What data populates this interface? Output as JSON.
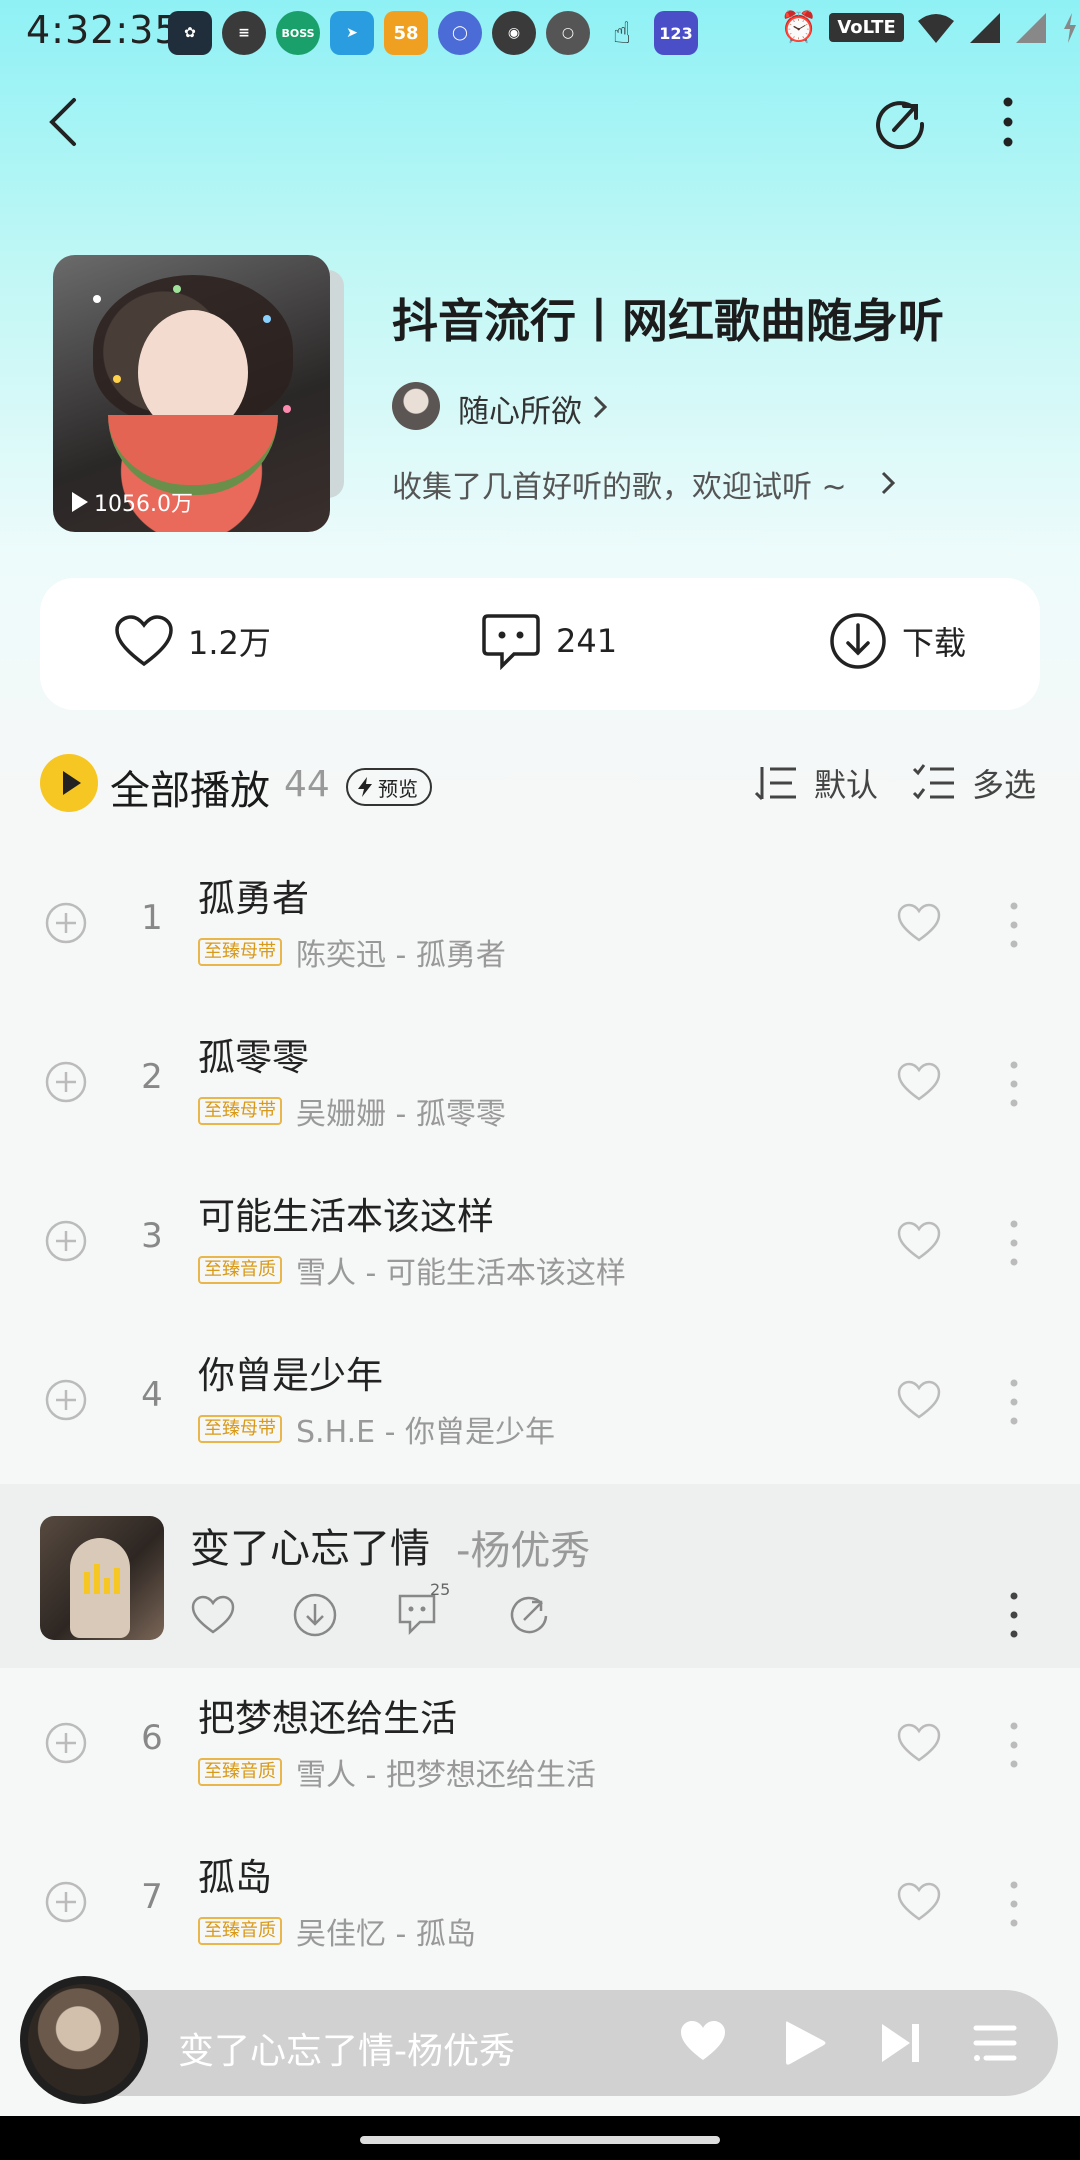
{
  "status_bar": {
    "time": "4:32:35",
    "badges": {
      "boss": "BOSS",
      "fifty_eight": "58",
      "num": "123",
      "volte": "VoLTE"
    }
  },
  "header": {
    "back_icon": "chevron-left-icon",
    "share_icon": "share-icon",
    "more_icon": "more-vertical-icon"
  },
  "playlist": {
    "title": "抖音流行丨网红歌曲随身听",
    "play_count": "1056.0万",
    "creator": "随心所欲",
    "description": "收集了几首好听的歌，欢迎试听 ~"
  },
  "actions": {
    "like_count": "1.2万",
    "comment_count": "241",
    "download_label": "下载"
  },
  "play_all": {
    "label": "全部播放",
    "count": "44",
    "preview_label": "预览",
    "sort_label": "默认",
    "multi_select_label": "多选"
  },
  "songs": [
    {
      "num": "1",
      "title": "孤勇者",
      "badge": "至臻母带",
      "artist": "陈奕迅 - 孤勇者"
    },
    {
      "num": "2",
      "title": "孤零零",
      "badge": "至臻母带",
      "artist": "吴姗姗 - 孤零零"
    },
    {
      "num": "3",
      "title": "可能生活本该这样",
      "badge": "至臻音质",
      "artist": "雪人 - 可能生活本该这样"
    },
    {
      "num": "4",
      "title": "你曾是少年",
      "badge": "至臻母带",
      "artist": "S.H.E - 你曾是少年"
    },
    {
      "num": "6",
      "title": "把梦想还给生活",
      "badge": "至臻音质",
      "artist": "雪人 - 把梦想还给生活"
    },
    {
      "num": "7",
      "title": "孤岛",
      "badge": "至臻音质",
      "artist": "吴佳忆 - 孤岛"
    }
  ],
  "now_playing": {
    "title": "变了心忘了情",
    "artist": "-杨优秀",
    "comment_count": "25"
  },
  "mini_player": {
    "title": "变了心忘了情-杨优秀"
  },
  "colors": {
    "accent": "#f6c623",
    "badge": "#d99a1a",
    "header_bg": "#8ff1f5"
  }
}
